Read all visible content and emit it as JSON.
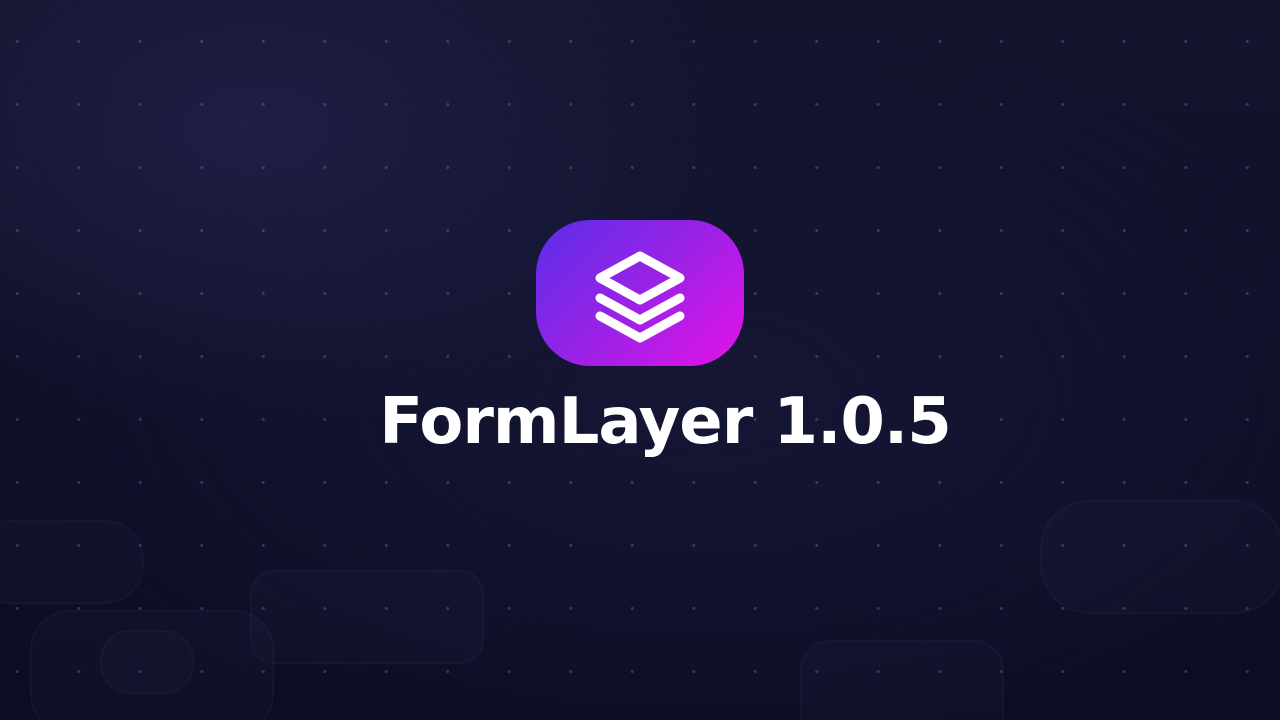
{
  "app": {
    "title": "FormLayer 1.0.5",
    "logo_icon": "stacked-layers-icon",
    "accent_gradient": [
      "#5a2ee8",
      "#e413e8"
    ]
  }
}
